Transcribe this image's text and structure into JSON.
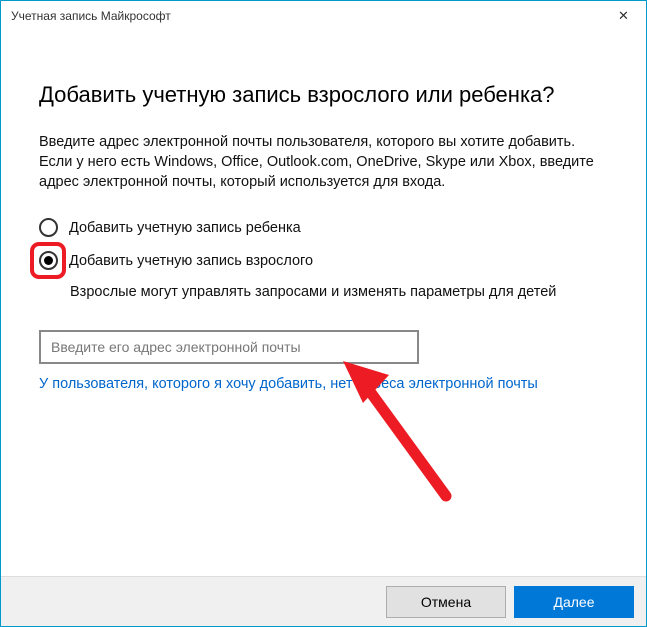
{
  "titlebar": {
    "title": "Учетная запись Майкрософт"
  },
  "heading": "Добавить учетную запись взрослого или ребенка?",
  "description": "Введите адрес электронной почты пользователя, которого вы хотите добавить. Если у него есть Windows, Office, Outlook.com, OneDrive, Skype или Xbox, введите адрес электронной почты, который используется для входа.",
  "radios": {
    "child": "Добавить учетную запись ребенка",
    "adult": "Добавить учетную запись взрослого"
  },
  "hint": "Взрослые могут управлять запросами и изменять параметры для детей",
  "email": {
    "placeholder": "Введите его адрес электронной почты",
    "value": ""
  },
  "link": "У пользователя, которого я хочу добавить, нет адреса электронной почты",
  "buttons": {
    "cancel": "Отмена",
    "next": "Далее"
  }
}
